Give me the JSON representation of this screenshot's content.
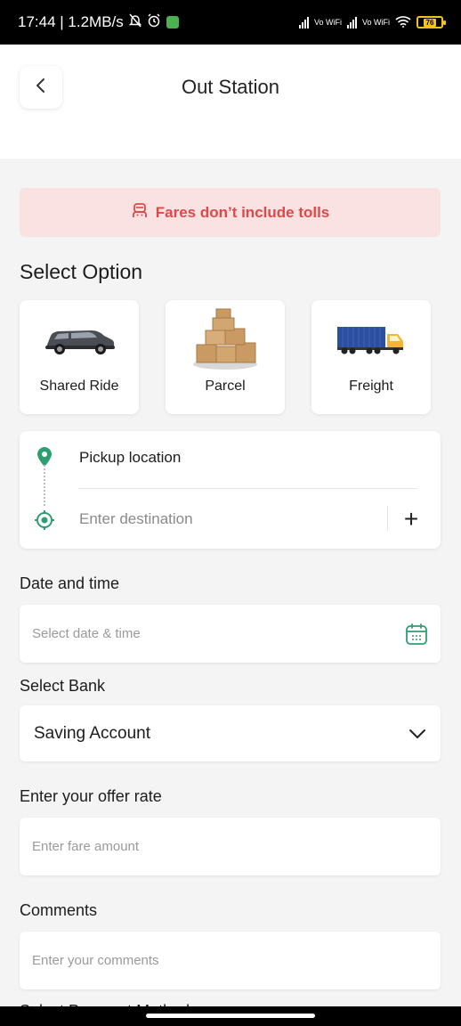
{
  "status_bar": {
    "time_and_speed": "17:44 | 1.2MB/s",
    "network_1": "Vo WiFi",
    "network_2": "Vo WiFi",
    "battery": "76"
  },
  "header": {
    "title": "Out Station"
  },
  "banner": {
    "text": "Fares don’t include tolls",
    "color": "#e04848"
  },
  "options": {
    "title": "Select Option",
    "items": [
      {
        "label": "Shared Ride",
        "icon": "suv-car-icon"
      },
      {
        "label": "Parcel",
        "icon": "parcel-boxes-icon"
      },
      {
        "label": "Freight",
        "icon": "freight-truck-icon"
      }
    ]
  },
  "location": {
    "pickup": "Pickup location",
    "destination_placeholder": "Enter destination",
    "add_stop": "+",
    "accent": "#2e9e72"
  },
  "date_time": {
    "label": "Date and time",
    "placeholder": "Select date & time"
  },
  "bank": {
    "label": "Select Bank",
    "selected": "Saving Account"
  },
  "offer": {
    "label": "Enter your offer rate",
    "placeholder": "Enter fare amount"
  },
  "comments": {
    "label": "Comments",
    "placeholder": "Enter your comments"
  },
  "next_section_peek": "Select Payment Method"
}
